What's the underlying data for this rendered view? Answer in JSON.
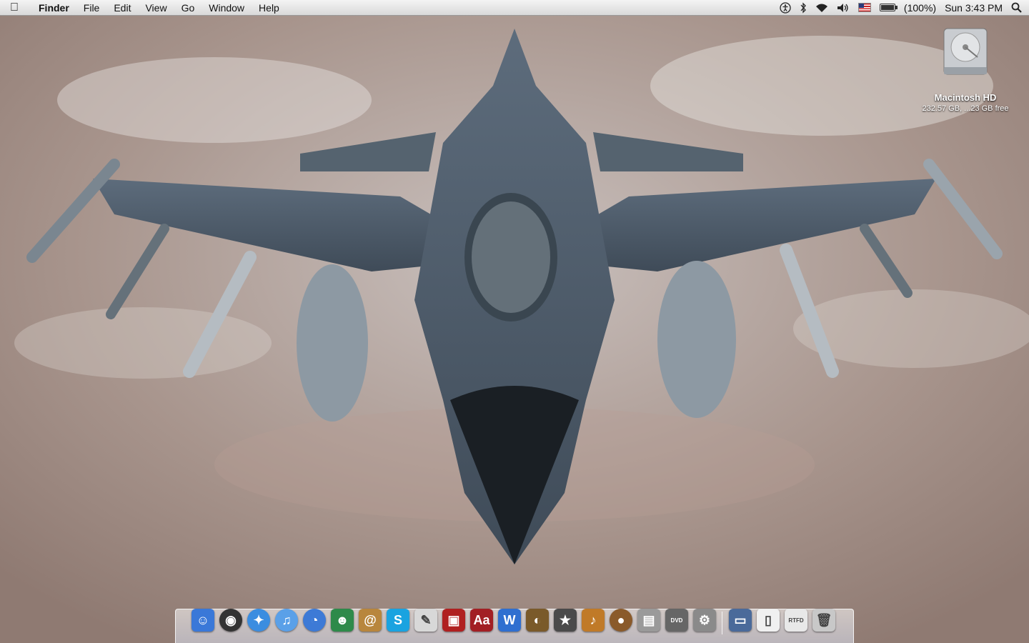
{
  "menubar": {
    "app_name": "Finder",
    "menus": [
      "File",
      "Edit",
      "View",
      "Go",
      "Window",
      "Help"
    ],
    "status": {
      "icons": [
        "accessibility-icon",
        "bluetooth-icon",
        "wifi-icon",
        "volume-icon",
        "us-flag-icon"
      ],
      "battery_percent": "(100%)",
      "battery_level": 1.0,
      "clock": "Sun 3:43 PM"
    }
  },
  "desktop": {
    "hd_name": "Macintosh HD",
    "hd_info": "232.57 GB, ...23 GB free"
  },
  "dock": {
    "apps": [
      {
        "name": "finder",
        "glyph": "☺",
        "color": "#3a78d8"
      },
      {
        "name": "dashboard",
        "glyph": "◉",
        "color": "#333333"
      },
      {
        "name": "safari",
        "glyph": "✦",
        "color": "#3b8de0"
      },
      {
        "name": "itunes",
        "glyph": "♫",
        "color": "#5aa0e8"
      },
      {
        "name": "ichat",
        "glyph": "◔",
        "color": "#3d7ad6"
      },
      {
        "name": "buddies",
        "glyph": "☻",
        "color": "#2e8a4a"
      },
      {
        "name": "address-book",
        "glyph": "@",
        "color": "#b8863d"
      },
      {
        "name": "skype",
        "glyph": "S",
        "color": "#1aa3e0"
      },
      {
        "name": "textedit",
        "glyph": "✎",
        "color": "#d8d8d8"
      },
      {
        "name": "photo-booth",
        "glyph": "▣",
        "color": "#b02020"
      },
      {
        "name": "dictionary",
        "glyph": "Aa",
        "color": "#a21f24"
      },
      {
        "name": "word",
        "glyph": "W",
        "color": "#2f6fd0"
      },
      {
        "name": "iphoto",
        "glyph": "◐",
        "color": "#7a5a2a"
      },
      {
        "name": "imovie",
        "glyph": "★",
        "color": "#4a4a4a"
      },
      {
        "name": "garageband",
        "glyph": "♪",
        "color": "#c07a28"
      },
      {
        "name": "coconut",
        "glyph": "●",
        "color": "#8a5a2a"
      },
      {
        "name": "image-capture",
        "glyph": "▤",
        "color": "#9a9a9a"
      },
      {
        "name": "dvd-player",
        "glyph": "DVD",
        "color": "#666666"
      },
      {
        "name": "system-preferences",
        "glyph": "⚙",
        "color": "#8a8a8a"
      }
    ],
    "docs": [
      {
        "name": "pictures-stack",
        "glyph": "▭",
        "color": "#4a6a9a"
      },
      {
        "name": "document",
        "glyph": "▯",
        "color": "#f0f0f0"
      },
      {
        "name": "rtfd-document",
        "glyph": "RTFD",
        "color": "#e8e8e8"
      },
      {
        "name": "trash",
        "glyph": "🗑",
        "color": "#c8c8c8"
      }
    ]
  }
}
